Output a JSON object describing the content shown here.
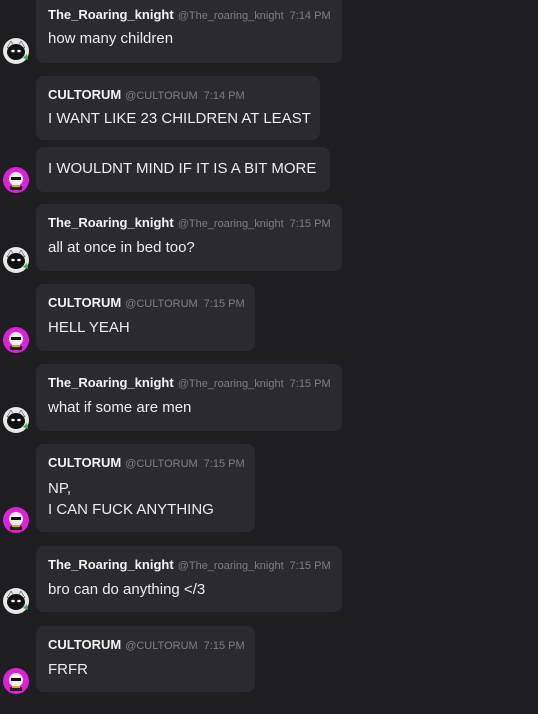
{
  "messages": [
    {
      "name": "The_Roaring_knight",
      "handle": "@The_roaring_knight",
      "time": "7:14 PM",
      "lines": [
        "how many children"
      ]
    },
    {
      "name": "CULTORUM",
      "handle": "@CULTORUM",
      "time": "7:14 PM",
      "lines": [
        "I WANT LIKE 23 CHILDREN AT LEAST"
      ]
    },
    {
      "lines": [
        "I WOULDNT MIND IF IT IS A BIT  MORE"
      ]
    },
    {
      "name": "The_Roaring_knight",
      "handle": "@The_roaring_knight",
      "time": "7:15 PM",
      "lines": [
        "all at once in bed too?"
      ]
    },
    {
      "name": "CULTORUM",
      "handle": "@CULTORUM",
      "time": "7:15 PM",
      "lines": [
        "HELL YEAH"
      ]
    },
    {
      "name": "The_Roaring_knight",
      "handle": "@The_roaring_knight",
      "time": "7:15 PM",
      "lines": [
        "what if some are men"
      ]
    },
    {
      "name": "CULTORUM",
      "handle": "@CULTORUM",
      "time": "7:15 PM",
      "lines": [
        "NP,",
        "I CAN FUCK ANYTHING"
      ]
    },
    {
      "name": "The_Roaring_knight",
      "handle": "@The_roaring_knight",
      "time": "7:15 PM",
      "lines": [
        "bro can do anything </3"
      ]
    },
    {
      "name": "CULTORUM",
      "handle": "@CULTORUM",
      "time": "7:15 PM",
      "lines": [
        "FRFR"
      ]
    }
  ]
}
